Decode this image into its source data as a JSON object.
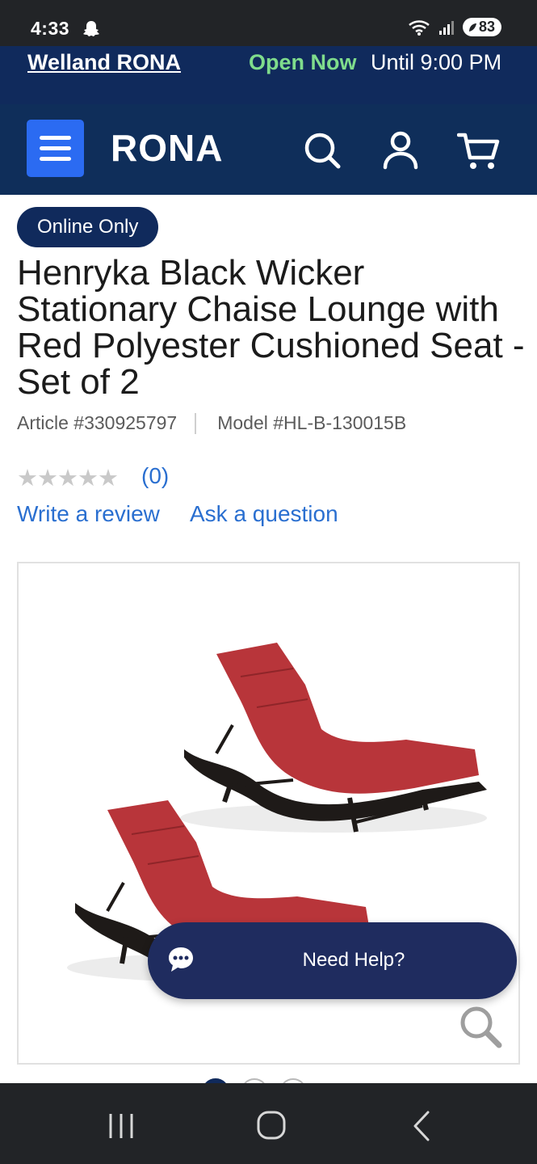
{
  "status_bar": {
    "time": "4:33",
    "battery": "83"
  },
  "store_bar": {
    "store_name": "Welland RONA",
    "open_status": "Open Now",
    "hours": "Until 9:00 PM"
  },
  "header": {
    "logo": "RONA",
    "icons": [
      "menu-icon",
      "search-icon",
      "account-icon",
      "cart-icon"
    ]
  },
  "product": {
    "badge": "Online Only",
    "title": "Henryka Black Wicker Stationary Chaise Lounge with Red Polyester Cushioned Seat - Set of 2",
    "article": "Article #330925797",
    "model": "Model #HL-B-130015B",
    "rating_stars": "★★★★★",
    "rating": 0,
    "review_count": "(0)",
    "write_review": "Write a review",
    "ask_question": "Ask a question"
  },
  "gallery": {
    "image_count": 3,
    "active_index": 0
  },
  "help_button": {
    "label": "Need Help?"
  },
  "colors": {
    "brand_navy": "#102a5c",
    "menu_blue": "#2b6bf2",
    "link_blue": "#2a6fd0",
    "open_green": "#7fdc8c",
    "cushion_red": "#b8353a"
  }
}
